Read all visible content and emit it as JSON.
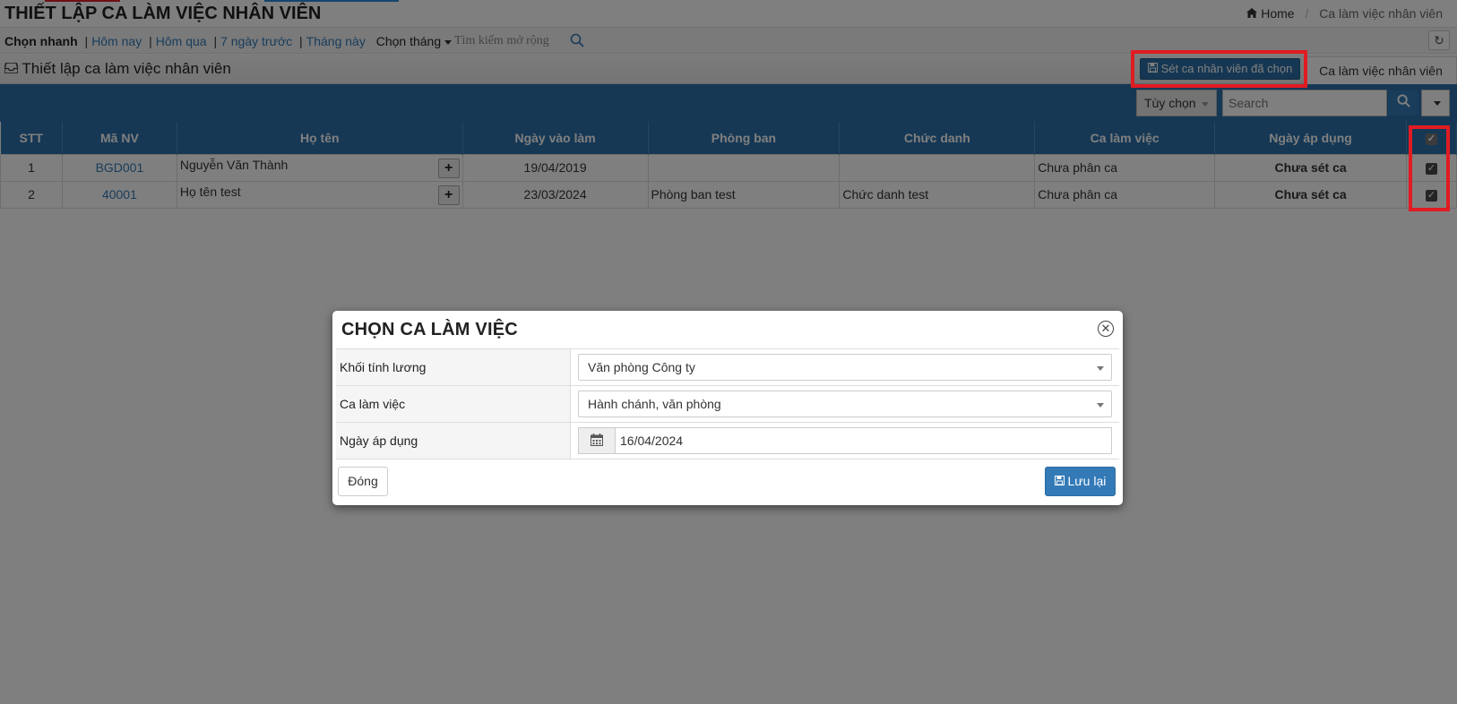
{
  "header": {
    "title": "THIẾT LẬP CA LÀM VIỆC NHÂN VIÊN",
    "breadcrumb_home": "Home",
    "breadcrumb_current": "Ca làm việc nhân viên"
  },
  "quick": {
    "label": "Chọn nhanh",
    "items": [
      "Hôm nay",
      "Hôm qua",
      "7 ngày trước",
      "Tháng này"
    ],
    "month_dropdown": "Chọn tháng",
    "search_placeholder": "Tìm kiếm mở rộng"
  },
  "panel": {
    "title": "Thiết lập ca làm việc nhân viên",
    "set_button": "Sét ca nhân viên đã chọn",
    "tab_label": "Ca làm việc nhân viên"
  },
  "toolbar": {
    "options_label": "Tùy chọn",
    "search_placeholder": "Search"
  },
  "table": {
    "columns": [
      "STT",
      "Mã NV",
      "Họ tên",
      "Ngày vào làm",
      "Phòng ban",
      "Chức danh",
      "Ca làm việc",
      "Ngày áp dụng"
    ],
    "rows": [
      {
        "stt": "1",
        "ma_nv": "BGD001",
        "ho_ten": "Nguyễn Văn Thành",
        "ngay_vao_lam": "19/04/2019",
        "phong_ban": "",
        "chuc_danh": "",
        "ca_lam_viec": "Chưa phân ca",
        "ngay_ap_dung": "Chưa sét ca",
        "checked": true
      },
      {
        "stt": "2",
        "ma_nv": "40001",
        "ho_ten": "Họ tên test",
        "ngay_vao_lam": "23/03/2024",
        "phong_ban": "Phòng ban test",
        "chuc_danh": "Chức danh test",
        "ca_lam_viec": "Chưa phân ca",
        "ngay_ap_dung": "Chưa sét ca",
        "checked": true
      }
    ]
  },
  "modal": {
    "title": "CHỌN CA LÀM VIỆC",
    "fields": [
      {
        "label": "Khối tính lương",
        "value": "Văn phòng Công ty"
      },
      {
        "label": "Ca làm việc",
        "value": "Hành chánh, văn phòng"
      },
      {
        "label": "Ngày áp dụng",
        "value": "16/04/2024"
      }
    ],
    "close_button": "Đóng",
    "save_button": "Lưu lại"
  },
  "colors": {
    "header_blue": "#2c71aa",
    "primary": "#337ab7",
    "highlight_red": "#e11b22"
  }
}
